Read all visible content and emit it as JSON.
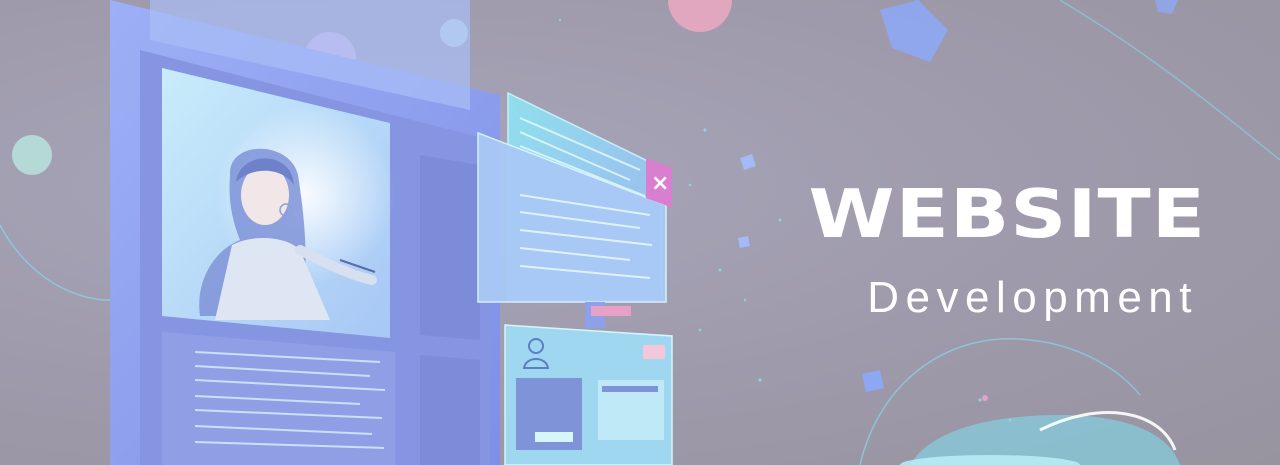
{
  "banner": {
    "title": "WEBSITE",
    "subtitle": "Development"
  },
  "colors": {
    "background": "#9e9aab",
    "accent_cyan": "#7fe6f2",
    "accent_pink": "#e7a1c8",
    "monitor_blue": "#8fa2f0"
  },
  "icons": [
    "close-icon",
    "user-icon"
  ]
}
